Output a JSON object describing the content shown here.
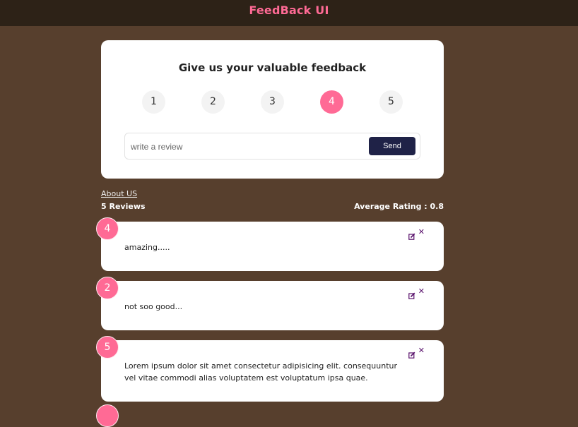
{
  "header": {
    "title": "FeedBack UI"
  },
  "form": {
    "heading": "Give us your valuable feedback",
    "ratings": [
      "1",
      "2",
      "3",
      "4",
      "5"
    ],
    "selected_rating": "4",
    "review_placeholder": "write a review",
    "send_label": "Send"
  },
  "about_link": "About US",
  "stats": {
    "review_count": "5 Reviews",
    "average_rating": "Average Rating : 0.8"
  },
  "feedback_items": [
    {
      "rating": "4",
      "text": "amazing....."
    },
    {
      "rating": "2",
      "text": "not soo good..."
    },
    {
      "rating": "5",
      "text": "Lorem ipsum dolor sit amet consectetur adipisicing elit. consequuntur vel vitae commodi alias voluptatem est voluptatum ipsa quae."
    }
  ],
  "colors": {
    "accent": "#ff6a95",
    "background": "#573f2d",
    "topbar": "#2d2217",
    "send_button": "#1f2247",
    "icon": "#58106b"
  },
  "icons": {
    "edit": "edit-icon",
    "delete": "close-icon"
  }
}
